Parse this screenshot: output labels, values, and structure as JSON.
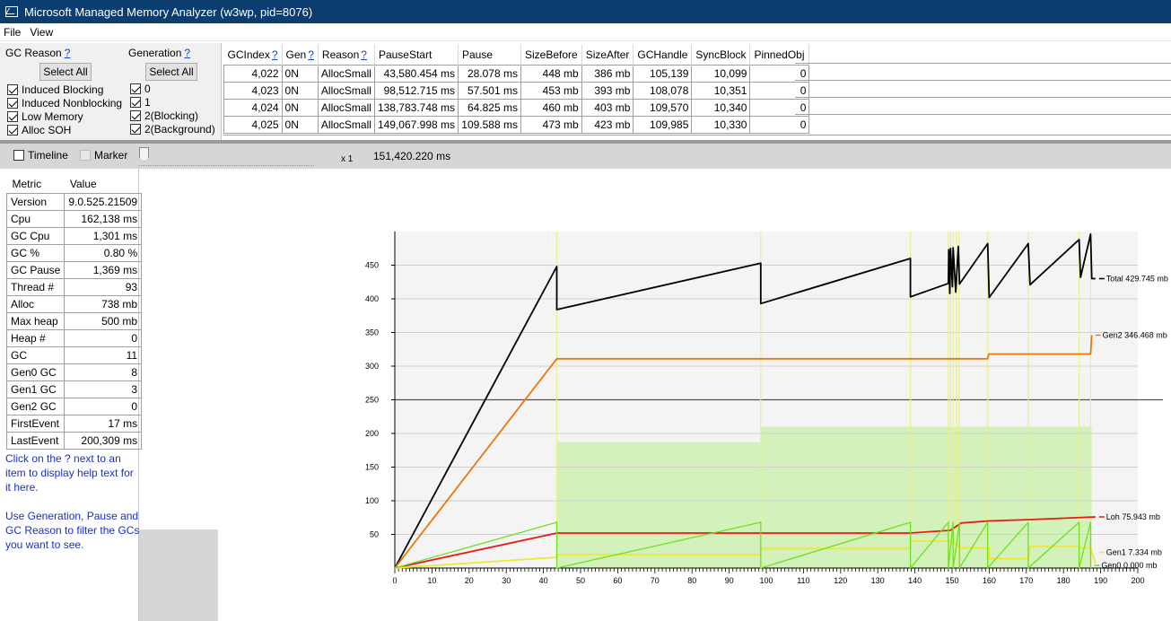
{
  "window": {
    "title": "Microsoft Managed Memory Analyzer (w3wp, pid=8076)"
  },
  "menu": [
    "File",
    "View"
  ],
  "filters": {
    "gc_reason": {
      "label": "GC Reason",
      "help": "?",
      "select_all": "Select All",
      "items": [
        {
          "label": "Induced Blocking",
          "checked": true
        },
        {
          "label": "Induced Nonblocking",
          "checked": true
        },
        {
          "label": "Low Memory",
          "checked": true
        },
        {
          "label": "Alloc SOH",
          "checked": true
        }
      ]
    },
    "generation": {
      "label": "Generation",
      "help": "?",
      "select_all": "Select All",
      "items": [
        {
          "label": "0",
          "checked": true
        },
        {
          "label": "1",
          "checked": true
        },
        {
          "label": "2(Blocking)",
          "checked": true
        },
        {
          "label": "2(Background)",
          "checked": true
        }
      ]
    }
  },
  "gc_table": {
    "columns": [
      {
        "label": "GCIndex",
        "help": "?"
      },
      {
        "label": "Gen",
        "help": "?"
      },
      {
        "label": "Reason",
        "help": "?"
      },
      {
        "label": "PauseStart",
        "help": ""
      },
      {
        "label": "Pause",
        "help": ""
      },
      {
        "label": "SizeBefore",
        "help": ""
      },
      {
        "label": "SizeAfter",
        "help": ""
      },
      {
        "label": "GCHandle",
        "help": ""
      },
      {
        "label": "SyncBlock",
        "help": ""
      },
      {
        "label": "PinnedObj",
        "help": ""
      }
    ],
    "rows": [
      [
        "4,022",
        "0N",
        "AllocSmall",
        "43,580.454 ms",
        "28.078 ms",
        "448 mb",
        "386 mb",
        "105,139",
        "10,099",
        "0"
      ],
      [
        "4,023",
        "0N",
        "AllocSmall",
        "98,512.715 ms",
        "57.501 ms",
        "453 mb",
        "393 mb",
        "108,078",
        "10,351",
        "0"
      ],
      [
        "4,024",
        "0N",
        "AllocSmall",
        "138,783.748 ms",
        "64.825 ms",
        "460 mb",
        "403 mb",
        "109,570",
        "10,340",
        "0"
      ],
      [
        "4,025",
        "0N",
        "AllocSmall",
        "149,067.998 ms",
        "109.588 ms",
        "473 mb",
        "423 mb",
        "109,985",
        "10,330",
        "0"
      ]
    ]
  },
  "timeline_bar": {
    "timeline_label": "Timeline",
    "timeline_checked": false,
    "marker_label": "Marker",
    "marker_checked": false,
    "zoom_label": "x 1",
    "time_value": "151,420.220 ms"
  },
  "metrics": {
    "headers": [
      "Metric",
      "Value"
    ],
    "rows": [
      [
        "Version",
        "9.0.525.21509"
      ],
      [
        "Cpu",
        "162,138 ms"
      ],
      [
        "GC Cpu",
        "1,301 ms"
      ],
      [
        "GC %",
        "0.80 %"
      ],
      [
        "GC Pause",
        "1,369 ms"
      ],
      [
        "Thread #",
        "93"
      ],
      [
        "Alloc",
        "738 mb"
      ],
      [
        "Max heap",
        "500 mb"
      ],
      [
        "Heap #",
        "0"
      ],
      [
        "GC",
        "11"
      ],
      [
        "Gen0 GC",
        "8"
      ],
      [
        "Gen1 GC",
        "3"
      ],
      [
        "Gen2 GC",
        "0"
      ],
      [
        "FirstEvent",
        "17 ms"
      ],
      [
        "LastEvent",
        "200,309 ms"
      ]
    ]
  },
  "help_text": [
    "Click on the ? next to an item to display help text for it here.",
    "Use Generation, Pause and GC Reason to filter the GCs you want to see."
  ],
  "chart_data": {
    "type": "line",
    "xlim": [
      0,
      200
    ],
    "ylim": [
      0,
      500
    ],
    "x_ticks": [
      0,
      10,
      20,
      30,
      40,
      50,
      60,
      70,
      80,
      90,
      100,
      110,
      120,
      130,
      140,
      150,
      160,
      170,
      180,
      190,
      200
    ],
    "y_ticks": [
      50,
      100,
      150,
      200,
      250,
      300,
      350,
      400,
      450
    ],
    "reference_line": 250,
    "grid": true,
    "series": [
      {
        "name": "Total",
        "end_label": "Total 429.745 mb",
        "color": "#000000",
        "points": [
          [
            0,
            0
          ],
          [
            43.6,
            448
          ],
          [
            43.6,
            384
          ],
          [
            98.5,
            453
          ],
          [
            98.5,
            393
          ],
          [
            138.8,
            460
          ],
          [
            138.8,
            403
          ],
          [
            149,
            423
          ],
          [
            149.1,
            473
          ],
          [
            149.4,
            408
          ],
          [
            149.6,
            475
          ],
          [
            150.1,
            418
          ],
          [
            150.3,
            476
          ],
          [
            151,
            410
          ],
          [
            151.7,
            478
          ],
          [
            152,
            422
          ],
          [
            159.6,
            482
          ],
          [
            160,
            402
          ],
          [
            170.5,
            482
          ],
          [
            171,
            421
          ],
          [
            184.2,
            488
          ],
          [
            184.6,
            432
          ],
          [
            187.3,
            496
          ],
          [
            187.6,
            430
          ],
          [
            188.6,
            430
          ]
        ]
      },
      {
        "name": "Gen2",
        "end_label": "Gen2 346.468 mb",
        "color": "#e8780c",
        "points": [
          [
            0,
            0
          ],
          [
            43.6,
            311
          ],
          [
            98.5,
            311
          ],
          [
            138.8,
            311
          ],
          [
            159.5,
            311
          ],
          [
            159.9,
            318
          ],
          [
            187.3,
            318
          ],
          [
            187.6,
            346
          ]
        ]
      },
      {
        "name": "Loh",
        "end_label": "Loh 75.943 mb",
        "color": "#e81a14",
        "points": [
          [
            0,
            0
          ],
          [
            43.6,
            52
          ],
          [
            138.8,
            52
          ],
          [
            149.5,
            56
          ],
          [
            152.5,
            67
          ],
          [
            160,
            70
          ],
          [
            171,
            72
          ],
          [
            188.6,
            76
          ]
        ]
      },
      {
        "name": "Gen1",
        "end_label": "Gen1 7.334 mb",
        "color": "#f0e830",
        "points": [
          [
            0,
            0
          ],
          [
            43.6,
            16
          ],
          [
            43.6,
            20
          ],
          [
            98.5,
            20
          ],
          [
            98.5,
            29
          ],
          [
            138.8,
            29
          ],
          [
            138.8,
            40
          ],
          [
            149,
            40
          ],
          [
            151,
            35
          ],
          [
            152,
            30
          ],
          [
            160,
            30
          ],
          [
            160,
            14
          ],
          [
            170.5,
            14
          ],
          [
            171,
            32
          ],
          [
            184.2,
            32
          ],
          [
            184.6,
            30
          ],
          [
            187.3,
            30
          ],
          [
            188.6,
            7
          ]
        ]
      },
      {
        "name": "Gen0",
        "end_label": "Gen0 0.000 mb",
        "color": "#70e020",
        "points": [
          [
            0,
            0
          ],
          [
            43.6,
            68
          ],
          [
            43.6,
            0
          ],
          [
            98.5,
            68
          ],
          [
            98.5,
            0
          ],
          [
            138.8,
            68
          ],
          [
            138.8,
            0
          ],
          [
            149,
            68
          ],
          [
            149,
            0
          ],
          [
            150.3,
            68
          ],
          [
            150.3,
            0
          ],
          [
            152,
            67
          ],
          [
            152,
            0
          ],
          [
            159.6,
            68
          ],
          [
            159.6,
            0
          ],
          [
            170.5,
            68
          ],
          [
            170.5,
            0
          ],
          [
            184.2,
            68
          ],
          [
            184.2,
            0
          ],
          [
            187.3,
            68
          ],
          [
            187.3,
            0
          ]
        ]
      }
    ],
    "gc_bands": [
      [
        43.6,
        98.5,
        187
      ],
      [
        98.5,
        149,
        210
      ],
      [
        149,
        160,
        210
      ],
      [
        160,
        187.6,
        210
      ]
    ],
    "gc_markers": [
      43.6,
      98.5,
      138.8,
      149,
      149.6,
      150.3,
      151.2,
      151.9,
      159.6,
      170.5,
      184.2,
      187.3
    ]
  }
}
